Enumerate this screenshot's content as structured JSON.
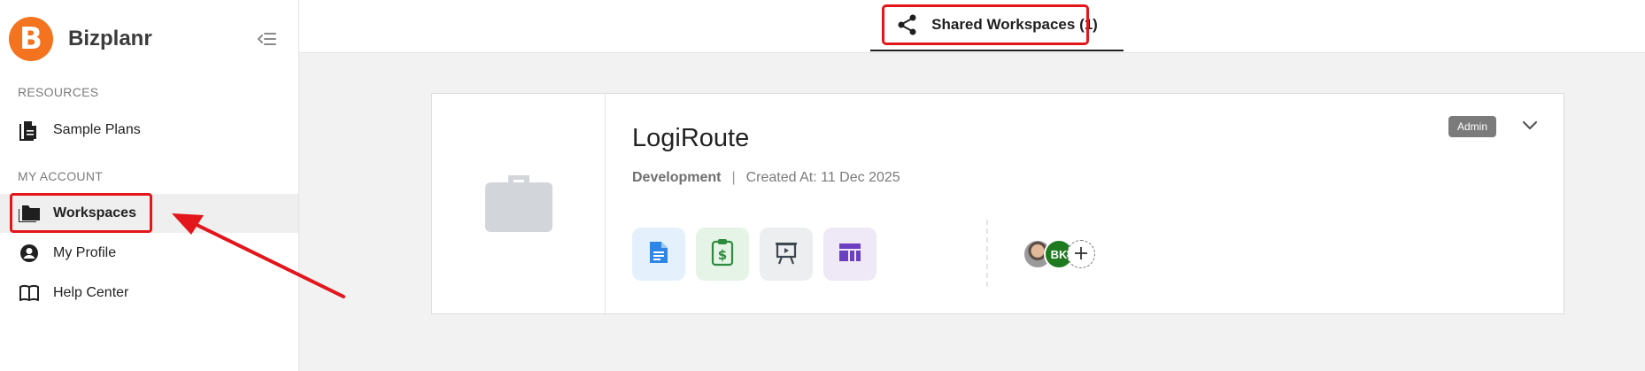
{
  "brand": {
    "name": "Bizplanr",
    "logo_letter": "B",
    "color": "#f4731f"
  },
  "sidebar": {
    "sections": [
      {
        "label": "RESOURCES"
      },
      {
        "label": "MY ACCOUNT"
      }
    ],
    "items": [
      {
        "label": "Sample Plans",
        "icon": "document-icon"
      },
      {
        "label": "Workspaces",
        "icon": "folder-icon",
        "active": true
      },
      {
        "label": "My Profile",
        "icon": "account-circle-icon"
      },
      {
        "label": "Help Center",
        "icon": "book-icon"
      }
    ]
  },
  "tabs": [
    {
      "label": "Shared Workspaces (1)",
      "icon": "share-icon",
      "active": true
    }
  ],
  "workspace": {
    "title": "LogiRoute",
    "stage": "Development",
    "separator": "|",
    "created": "Created At: 11 Dec 2025",
    "role_badge": "Admin",
    "tools": [
      {
        "icon": "document-icon",
        "bg": "#e4f1fd",
        "fg": "#2f86e6"
      },
      {
        "icon": "clipboard-dollar-icon",
        "bg": "#e6f4e7",
        "fg": "#2e8b3d"
      },
      {
        "icon": "presentation-board-icon",
        "bg": "#eceef0",
        "fg": "#3d4750"
      },
      {
        "icon": "dashboard-layout-icon",
        "bg": "#efe8f6",
        "fg": "#6a3fc1"
      }
    ],
    "members": [
      {
        "type": "photo"
      },
      {
        "type": "initials",
        "initials": "BK",
        "color": "#1f7a1f"
      }
    ]
  },
  "annotations": {
    "highlight_color": "#e3161b"
  }
}
